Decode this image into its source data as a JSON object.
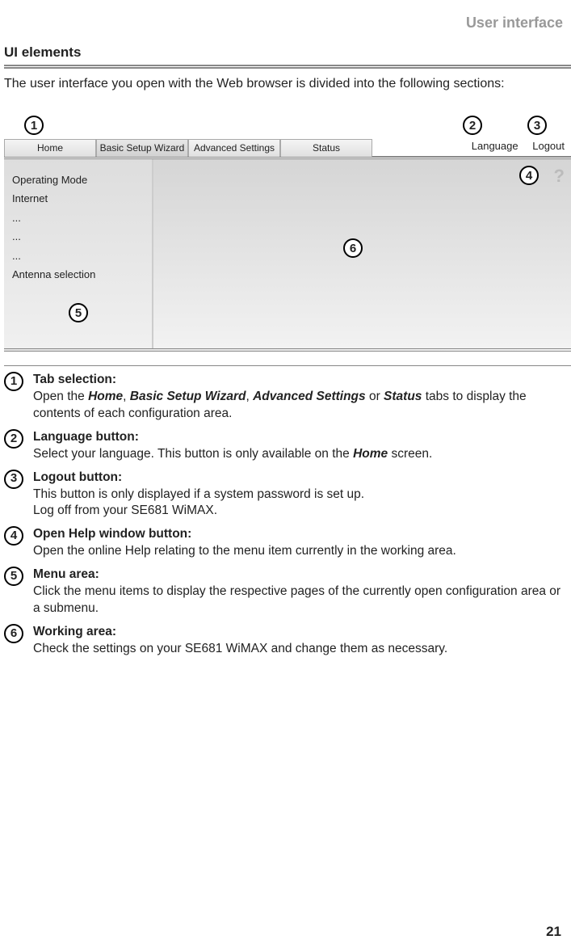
{
  "header": "User interface",
  "section": "UI elements",
  "intro": "The user interface you open with the Web browser is divided into the following sections:",
  "tabs": [
    "Home",
    "Basic Setup Wizard",
    "Advanced Settings",
    "Status"
  ],
  "langBtn": "Language",
  "logoutBtn": "Logout",
  "helpQ": "?",
  "sidebar": [
    "Operating Mode",
    "Internet",
    "...",
    "...",
    "...",
    "Antenna selection"
  ],
  "markers": {
    "m1": "1",
    "m2": "2",
    "m3": "3",
    "m4": "4",
    "m5": "5",
    "m6": "6"
  },
  "descs": [
    {
      "n": "1",
      "title": "Tab selection:",
      "body_a": "Open the ",
      "em": [
        "Home",
        "Basic Setup Wizard",
        "Advanced Settings",
        "Status"
      ],
      "sep": [
        " , ",
        " , ",
        " or "
      ],
      "body_b": " tabs to display the contents of each configuration area."
    },
    {
      "n": "2",
      "title": "Language button:",
      "body_a": "Select your language. This button is only available on the ",
      "em": [
        "Home"
      ],
      "body_b": " screen."
    },
    {
      "n": "3",
      "title": "Logout button:",
      "body_a": "This button is only displayed if a system password is set up.",
      "body_b": "Log off from your SE681 WiMAX."
    },
    {
      "n": "4",
      "title": "Open Help window button:",
      "body_a": "Open the online Help relating to the menu item currently in the working area.",
      "body_b": ""
    },
    {
      "n": "5",
      "title": "Menu area:",
      "body_a": "Click the menu items to display the respective pages of the currently open configuration area or a submenu.",
      "body_b": ""
    },
    {
      "n": "6",
      "title": "Working area:",
      "body_a": "Check the settings on your SE681 WiMAX and change them as necessary.",
      "body_b": ""
    }
  ],
  "pageNum": "21"
}
